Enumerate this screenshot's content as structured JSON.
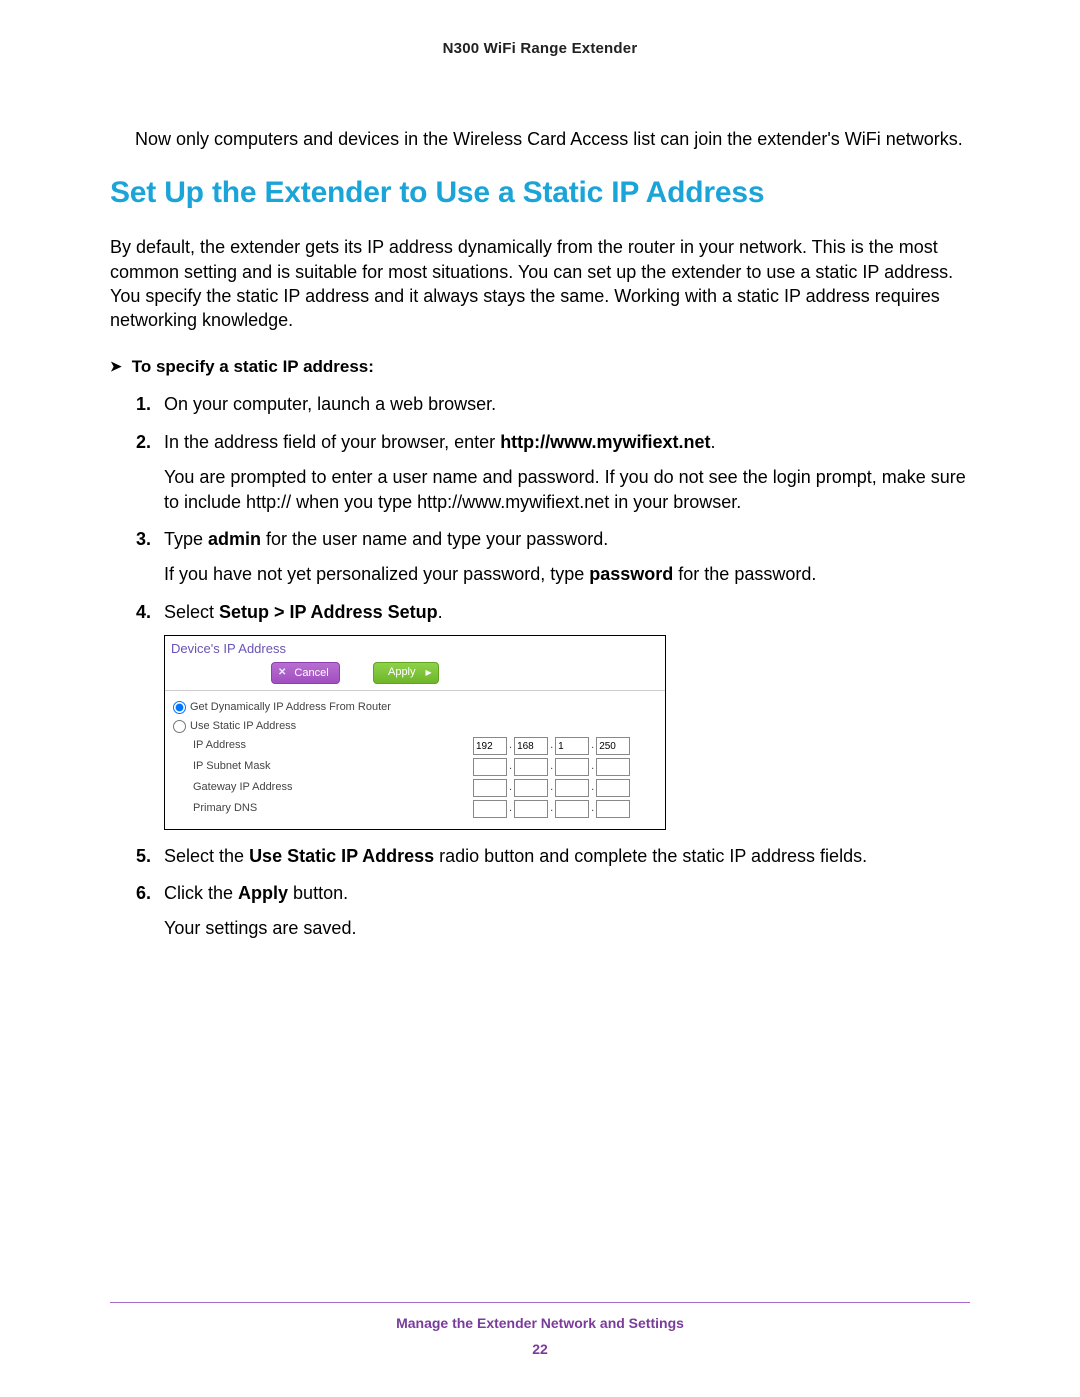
{
  "header": {
    "product": "N300 WiFi Range Extender"
  },
  "intro": "Now only computers and devices in the Wireless Card Access list can join the extender's WiFi networks.",
  "section": {
    "heading": "Set Up the Extender to Use a Static IP Address",
    "body": "By default, the extender gets its IP address dynamically from the router in your network. This is the most common setting and is suitable for most situations. You can set up the extender to use a static IP address. You specify the static IP address and it always stays the same. Working with a static IP address requires networking knowledge."
  },
  "procedure": {
    "title": "To specify a static IP address:",
    "steps": {
      "s1": "On your computer, launch a web browser.",
      "s2a": "In the address field of your browser, enter ",
      "s2b": "http://www.mywifiext.net",
      "s2c": ".",
      "s2note": "You are prompted to enter a user name and password. If you do not see the login prompt, make sure to include http:// when you type http://www.mywifiext.net in your browser.",
      "s3a": "Type ",
      "s3b": "admin",
      "s3c": " for the user name and type your password.",
      "s3note_a": "If you have not yet personalized your password, type ",
      "s3note_b": "password",
      "s3note_c": " for the password.",
      "s4a": "Select ",
      "s4b": "Setup > IP Address Setup",
      "s4c": ".",
      "s5a": "Select the ",
      "s5b": "Use Static IP Address",
      "s5c": " radio button and complete the static IP address fields.",
      "s6a": "Click the ",
      "s6b": "Apply",
      "s6c": " button.",
      "s6note": "Your settings are saved."
    }
  },
  "dialog": {
    "title": "Device's IP Address",
    "cancel": "Cancel",
    "apply": "Apply",
    "opt_dynamic": "Get Dynamically IP Address From Router",
    "opt_static": "Use Static IP Address",
    "lbl_ip": "IP Address",
    "lbl_subnet": "IP Subnet Mask",
    "lbl_gateway": "Gateway IP Address",
    "lbl_dns": "Primary DNS",
    "ip": {
      "a": "192",
      "b": "168",
      "c": "1",
      "d": "250"
    }
  },
  "footer": {
    "chapter": "Manage the Extender Network and Settings",
    "page": "22"
  }
}
